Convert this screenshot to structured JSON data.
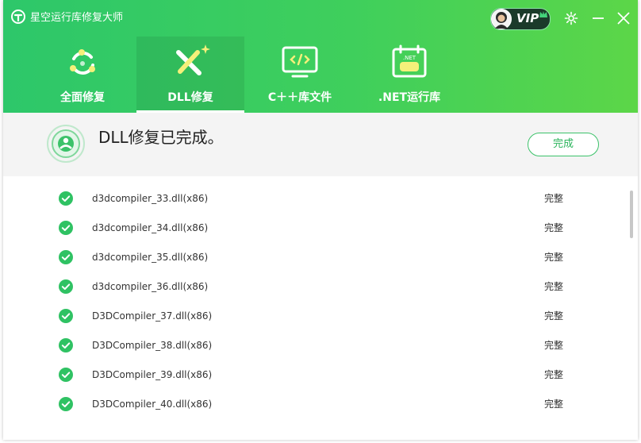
{
  "app": {
    "title": "星空运行库修复大师",
    "vip_label": "VIP"
  },
  "tabs": [
    {
      "label": "全面修复",
      "icon": "full-repair-icon",
      "active": false
    },
    {
      "label": "DLL修复",
      "icon": "dll-repair-icon",
      "active": true
    },
    {
      "label": "C＋＋库文件",
      "icon": "cpp-library-icon",
      "active": false
    },
    {
      "label": ".NET运行库",
      "icon": "dotnet-runtime-icon",
      "active": false
    }
  ],
  "status": {
    "message": "DLL修复已完成。",
    "done_button": "完成"
  },
  "files": [
    {
      "name": "d3dcompiler_33.dll(x86)",
      "status": "完整"
    },
    {
      "name": "d3dcompiler_34.dll(x86)",
      "status": "完整"
    },
    {
      "name": "d3dcompiler_35.dll(x86)",
      "status": "完整"
    },
    {
      "name": "d3dcompiler_36.dll(x86)",
      "status": "完整"
    },
    {
      "name": "D3DCompiler_37.dll(x86)",
      "status": "完整"
    },
    {
      "name": "D3DCompiler_38.dll(x86)",
      "status": "完整"
    },
    {
      "name": "D3DCompiler_39.dll(x86)",
      "status": "完整"
    },
    {
      "name": "D3DCompiler_40.dll(x86)",
      "status": "完整"
    }
  ],
  "colors": {
    "brand_green": "#3fcf5c",
    "check_green": "#2fc263"
  }
}
